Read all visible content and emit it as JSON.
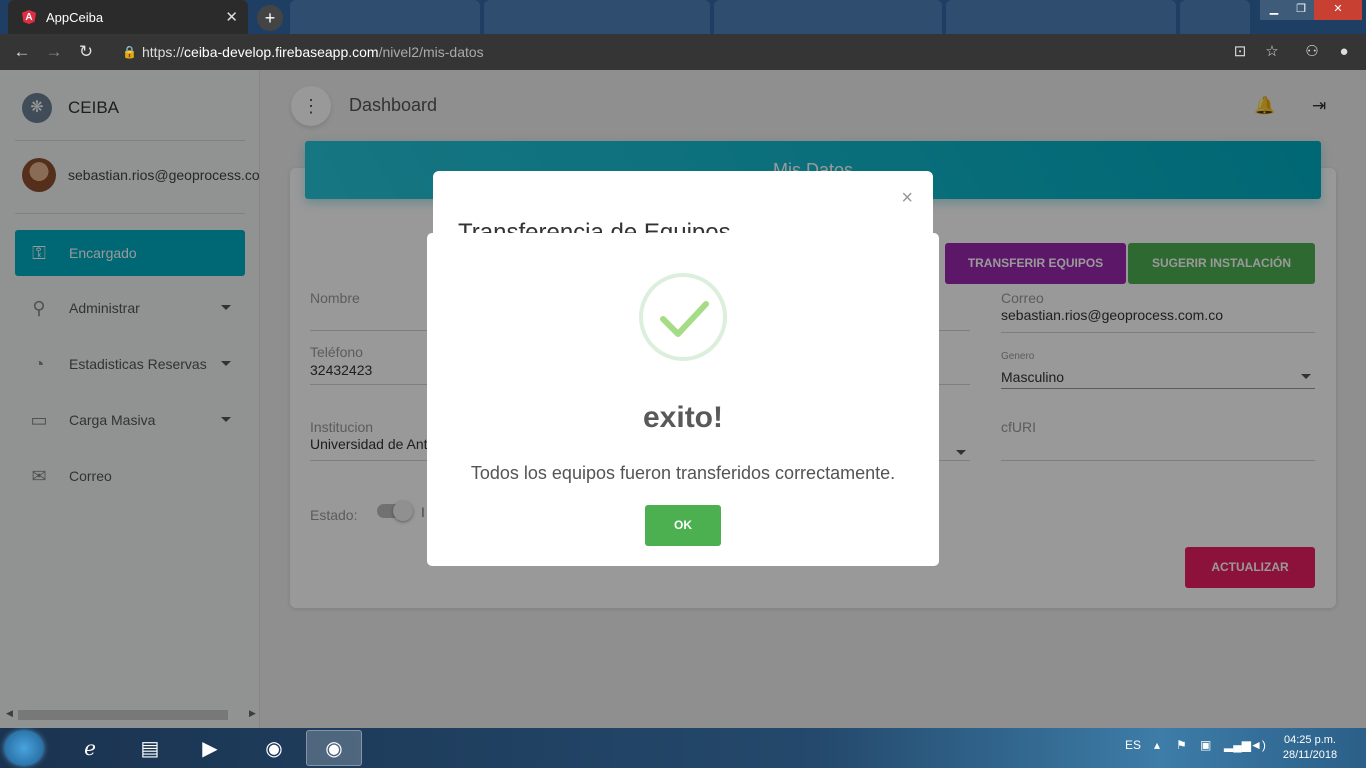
{
  "browser": {
    "active_tab_title": "AppCeiba",
    "new_tab_symbol": "+",
    "url_scheme": "https://",
    "url_host": "ceiba-develop.firebaseapp.com",
    "url_path": "/nivel2/mis-datos"
  },
  "sidebar": {
    "brand": "CEIBA",
    "user_email": "sebastian.rios@geoprocess.com.co",
    "items": [
      {
        "label": "Encargado",
        "icon": "key-icon",
        "active": true
      },
      {
        "label": "Administrar",
        "icon": "nodes-icon",
        "expandable": true
      },
      {
        "label": "Estadisticas Reservas",
        "icon": "pie-chart-icon",
        "expandable": true
      },
      {
        "label": "Carga Masiva",
        "icon": "clipboard-icon",
        "expandable": true
      },
      {
        "label": "Correo",
        "icon": "mail-icon"
      }
    ]
  },
  "topbar": {
    "title": "Dashboard"
  },
  "card": {
    "header": "Mis Datos",
    "buttons": {
      "transfer": "TRANSFERIR EQUIPOS",
      "suggest": "SUGERIR INSTALACIÓN",
      "update": "ACTUALIZAR"
    },
    "fields": {
      "nombre_label": "Nombre",
      "nombre_value": "",
      "telefono_label": "Teléfono",
      "telefono_value": "32432423",
      "institucion_label": "Institucion",
      "institucion_value": "Universidad de Ant",
      "correo_label": "Correo",
      "correo_value": "sebastian.rios@geoprocess.com.co",
      "genero_label": "Genero",
      "genero_value": "Masculino",
      "cfuri_label": "cfURI",
      "estado_label": "Estado:",
      "estado_value_partial": "I"
    }
  },
  "back_modal": {
    "title": "Transferencia de Equipos",
    "close": "×"
  },
  "alert": {
    "title": "exito!",
    "text": "Todos los equipos fueron transferidos correctamente.",
    "ok": "OK",
    "icon": "success-check-icon"
  },
  "taskbar": {
    "language": "ES",
    "time": "04:25 p.m.",
    "date": "28/11/2018"
  },
  "colors": {
    "primary": "#00acc1",
    "success": "#4caf50",
    "purple": "#9c27b0",
    "pink": "#e91e63"
  }
}
